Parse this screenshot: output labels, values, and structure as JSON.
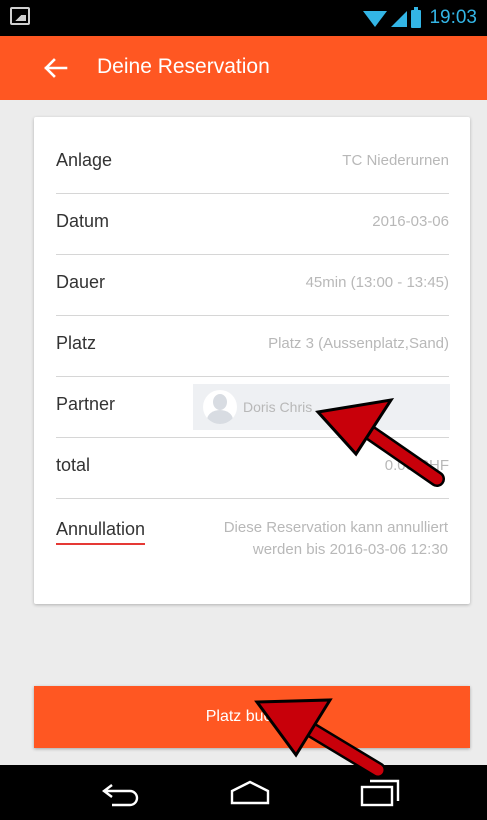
{
  "status_bar": {
    "time": "19:03",
    "icons": [
      "image-notification-icon",
      "wifi-icon",
      "signal-icon",
      "battery-icon"
    ]
  },
  "app_bar": {
    "title": "Deine Reservation",
    "back_icon": "arrow-left-icon",
    "color": "#ff5722"
  },
  "reservation": {
    "rows": [
      {
        "label": "Anlage",
        "value": "TC Niederurnen"
      },
      {
        "label": "Datum",
        "value": "2016-03-06"
      },
      {
        "label": "Dauer",
        "value": "45min (13:00 - 13:45)"
      },
      {
        "label": "Platz",
        "value": "Platz 3 (Aussenplatz,Sand)"
      },
      {
        "label": "Partner",
        "value": "Doris Chris"
      },
      {
        "label": "total",
        "value": "0.00 CHF"
      }
    ],
    "annulation": {
      "label": "Annullation",
      "text_line1": "Diese Reservation kann annulliert",
      "text_line2": "werden bis 2016-03-06  12:30"
    }
  },
  "book_button": {
    "label": "Platz buchen"
  },
  "nav_bar": {
    "icons": [
      "back-nav-icon",
      "home-nav-icon",
      "recents-nav-icon"
    ]
  },
  "annotations": {
    "arrow_color": "#c8000a"
  }
}
